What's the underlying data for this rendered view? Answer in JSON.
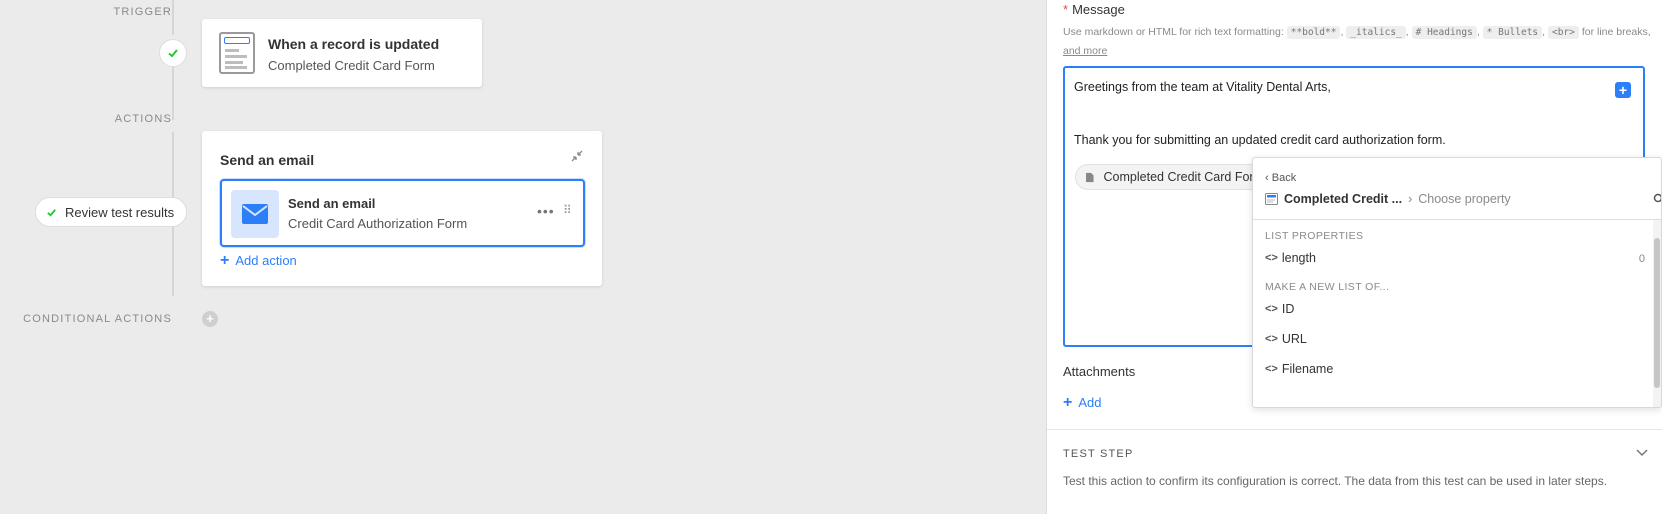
{
  "canvas": {
    "trigger_label": "TRIGGER",
    "actions_label": "ACTIONS",
    "conditional_label": "CONDITIONAL ACTIONS",
    "trigger_card": {
      "title": "When a record is updated",
      "subtitle": "Completed Credit Card Form"
    },
    "action_card": {
      "title": "Send an email",
      "item_title": "Send an email",
      "item_subtitle": "Credit Card Authorization Form",
      "more_icon": "ellipsis-icon",
      "add_action_label": "Add action"
    },
    "review_pill": "Review test results",
    "colors": {
      "accent": "#2d7ff9",
      "success": "#20c933",
      "canvas_bg": "#ebebeb"
    }
  },
  "panel": {
    "message_label": "Message",
    "required_marker": "*",
    "help": {
      "prefix": "Use markdown or HTML for rich text formatting:",
      "chips": [
        "**bold**",
        "_italics_",
        "# Headings",
        "* Bullets",
        "<br>"
      ],
      "suffix": "for line breaks,",
      "more": "and more"
    },
    "editor": {
      "line1": "Greetings from the team at Vitality Dental Arts,",
      "line2": "Thank you for submitting an updated credit card authorization form.",
      "token": "Completed Credit Card Form"
    },
    "attachments_label": "Attachments",
    "attach_add_label": "Add",
    "test_step_title": "TEST STEP",
    "test_step_desc": "Test this action to confirm its configuration is correct. The data from this test can be used in later steps."
  },
  "dropdown": {
    "back_label": "Back",
    "path_table": "Completed Credit ...",
    "path_sep": "›",
    "path_placeholder": "Choose property",
    "group_list_props": "LIST PROPERTIES",
    "length_label": "length",
    "length_count": "0",
    "group_new_list": "MAKE A NEW LIST OF...",
    "items": [
      "ID",
      "URL",
      "Filename"
    ],
    "code_glyph": "<>"
  }
}
